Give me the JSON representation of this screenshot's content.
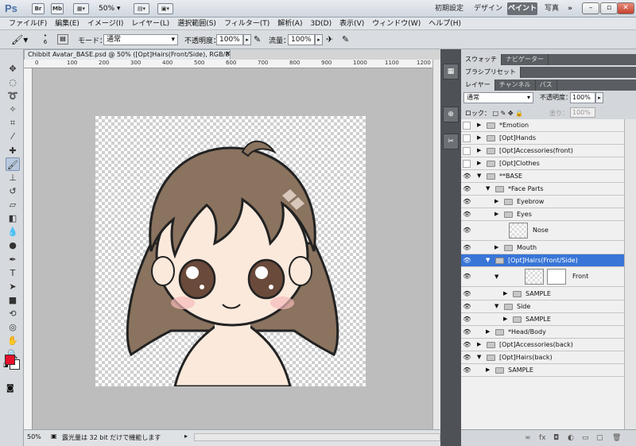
{
  "app": {
    "logo": "Ps",
    "title_icons": [
      "Br",
      "Mb"
    ],
    "zoom": "50%",
    "workspaces": [
      "初期設定",
      "デザイン",
      "ペイント",
      "写真"
    ],
    "active_workspace": "ペイント",
    "more": "»"
  },
  "menu": [
    "ファイル(F)",
    "編集(E)",
    "イメージ(I)",
    "レイヤー(L)",
    "選択範囲(S)",
    "フィルター(T)",
    "解析(A)",
    "3D(D)",
    "表示(V)",
    "ウィンドウ(W)",
    "ヘルプ(H)"
  ],
  "options": {
    "brush_size": "6",
    "mode_label": "モード：",
    "mode_value": "通常",
    "opacity_label": "不透明度：",
    "opacity_value": "100%",
    "flow_label": "流量：",
    "flow_value": "100%"
  },
  "document": {
    "tab_title": "Chibbit Avatar_BASE.psd @ 50% ([Opt]Hairs(Front/Side), RGB/8#) *",
    "ruler_labels": [
      "0",
      "100",
      "200",
      "300",
      "400",
      "500",
      "600",
      "700",
      "800",
      "900",
      "1000",
      "1100",
      "1200"
    ],
    "status_zoom": "50%",
    "status_message": "露光量は 32 bit だけで機能します"
  },
  "panels": {
    "top_tabs": [
      "スウォッチ",
      "ナビゲーター"
    ],
    "brush_tab": "ブラシプリセット",
    "layer_tabs": [
      "レイヤー",
      "チャンネル",
      "パス"
    ],
    "blend_mode": "通常",
    "opacity_label": "不透明度：",
    "opacity_value": "100%",
    "lock_label": "ロック：",
    "fill_label": "塗り：",
    "fill_value": "100%"
  },
  "layers": [
    {
      "name": "*Emotion",
      "indent": 0,
      "visible": false,
      "expanded": false
    },
    {
      "name": "[Opt]Hands",
      "indent": 0,
      "visible": false,
      "expanded": false
    },
    {
      "name": "[Opt]Accessories(front)",
      "indent": 0,
      "visible": false,
      "expanded": false
    },
    {
      "name": "[Opt]Clothes",
      "indent": 0,
      "visible": false,
      "expanded": false
    },
    {
      "name": "**BASE",
      "indent": 0,
      "visible": true,
      "expanded": true
    },
    {
      "name": "*Face Parts",
      "indent": 1,
      "visible": true,
      "expanded": true
    },
    {
      "name": "Eyebrow",
      "indent": 2,
      "visible": true,
      "expanded": false
    },
    {
      "name": "Eyes",
      "indent": 2,
      "visible": true,
      "expanded": false
    },
    {
      "name": "Nose",
      "indent": 2,
      "visible": true,
      "type": "thumb"
    },
    {
      "name": "Mouth",
      "indent": 2,
      "visible": true,
      "expanded": false
    },
    {
      "name": "[Opt]Hairs(Front/Side)",
      "indent": 1,
      "visible": true,
      "expanded": true,
      "selected": true
    },
    {
      "name": "Front",
      "indent": 2,
      "visible": true,
      "type": "mask"
    },
    {
      "name": "SAMPLE",
      "indent": 3,
      "visible": true,
      "expanded": false
    },
    {
      "name": "Side",
      "indent": 2,
      "visible": true,
      "expanded": true
    },
    {
      "name": "SAMPLE",
      "indent": 3,
      "visible": true,
      "expanded": false
    },
    {
      "name": "*Head/Body",
      "indent": 1,
      "visible": true,
      "expanded": false
    },
    {
      "name": "[Opt]Accessories(back)",
      "indent": 0,
      "visible": true,
      "expanded": false
    },
    {
      "name": "[Opt]Hairs(back)",
      "indent": 0,
      "visible": true,
      "expanded": true
    },
    {
      "name": "SAMPLE",
      "indent": 1,
      "visible": true,
      "expanded": false
    }
  ],
  "colors": {
    "foreground": "#e8102a",
    "background": "#ffffff",
    "selection": "#3875d7",
    "hair": "#8a735f",
    "skin": "#fbe9dc"
  }
}
